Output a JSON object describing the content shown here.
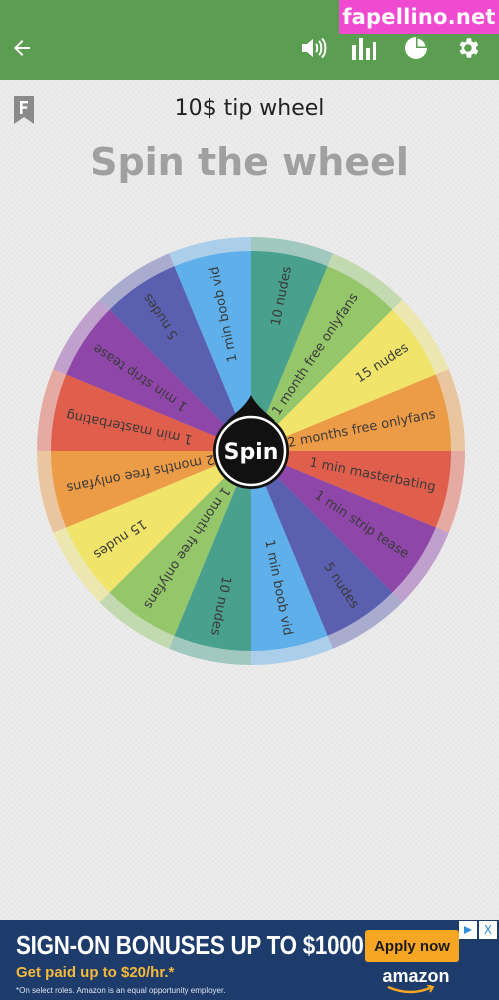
{
  "watermark": "fapellino.net",
  "toolbar": {
    "back_icon": "arrow-left-icon",
    "sound_icon": "speaker-icon",
    "results_icon": "bar-chart-icon",
    "stats_icon": "pie-chart-icon",
    "settings_icon": "gear-icon"
  },
  "wheel": {
    "title": "10$ tip wheel",
    "heading": "Spin the wheel",
    "spin_label": "Spin",
    "segments": [
      {
        "label": "10 nudes",
        "color": "#49a08c"
      },
      {
        "label": "1 month free onlyfans",
        "color": "#95c66a"
      },
      {
        "label": "15 nudes",
        "color": "#f0e46a"
      },
      {
        "label": "2 months free onlyfans",
        "color": "#ec9c47"
      },
      {
        "label": "1 min masterbating",
        "color": "#e05e4c"
      },
      {
        "label": "1 min strip tease",
        "color": "#8e47a8"
      },
      {
        "label": "5 nudes",
        "color": "#5b5fb0"
      },
      {
        "label": "1 min boob vid",
        "color": "#5fb0ea"
      },
      {
        "label": "10 nudes",
        "color": "#49a08c"
      },
      {
        "label": "1 month free onlyfans",
        "color": "#95c66a"
      },
      {
        "label": "15 nudes",
        "color": "#f0e46a"
      },
      {
        "label": "2 months free onlyfans",
        "color": "#ec9c47"
      },
      {
        "label": "1 min masterbating",
        "color": "#e05e4c"
      },
      {
        "label": "1 min strip tease",
        "color": "#8e47a8"
      },
      {
        "label": "5 nudes",
        "color": "#5b5fb0"
      },
      {
        "label": "1 min boob vid",
        "color": "#5fb0ea"
      }
    ]
  },
  "ad": {
    "headline": "SIGN-ON BONUSES UP TO $1000",
    "subline": "Get paid up to $20/hr.*",
    "fine_print": "*On select roles. Amazon is an equal opportunity employer.",
    "button_label": "Apply now",
    "brand": "amazon",
    "info_icon": "ad-info-icon",
    "close_label": "X"
  }
}
